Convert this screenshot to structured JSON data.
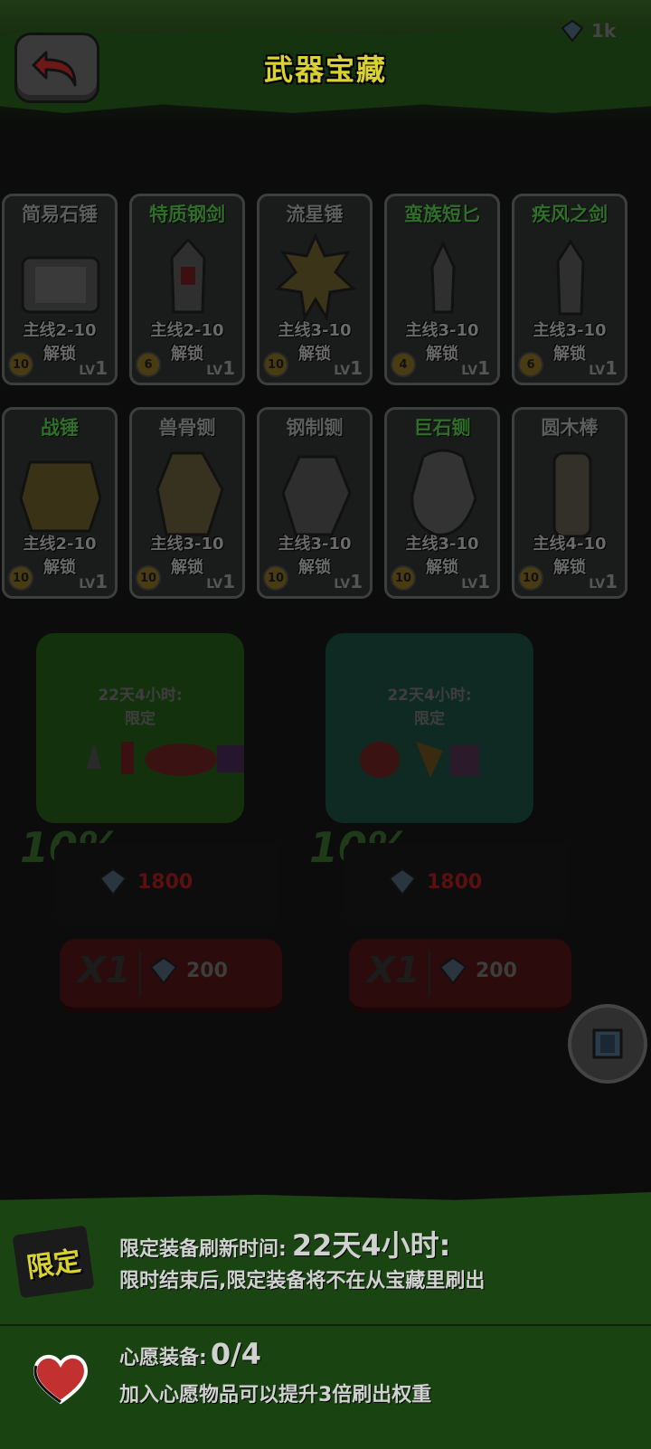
{
  "header": {
    "title": "武器宝藏",
    "currency_amount": "1k"
  },
  "weapons": [
    {
      "name": "简易石锤",
      "unlock": "主线2-10",
      "unlock_suffix": "解锁",
      "count": "10",
      "lv_prefix": "LV",
      "lv": "1",
      "name_color": "gray"
    },
    {
      "name": "特质钢剑",
      "unlock": "主线2-10",
      "unlock_suffix": "解锁",
      "count": "6",
      "lv_prefix": "LV",
      "lv": "1",
      "name_color": "green"
    },
    {
      "name": "流星锤",
      "unlock": "主线3-10",
      "unlock_suffix": "解锁",
      "count": "10",
      "lv_prefix": "LV",
      "lv": "1",
      "name_color": "gray"
    },
    {
      "name": "蛮族短匕",
      "unlock": "主线3-10",
      "unlock_suffix": "解锁",
      "count": "4",
      "lv_prefix": "LV",
      "lv": "1",
      "name_color": "green"
    },
    {
      "name": "疾风之剑",
      "unlock": "主线3-10",
      "unlock_suffix": "解锁",
      "count": "6",
      "lv_prefix": "LV",
      "lv": "1",
      "name_color": "green"
    },
    {
      "name": "战锤",
      "unlock": "主线2-10",
      "unlock_suffix": "解锁",
      "count": "10",
      "lv_prefix": "LV",
      "lv": "1",
      "name_color": "green"
    },
    {
      "name": "兽骨铡",
      "unlock": "主线3-10",
      "unlock_suffix": "解锁",
      "count": "10",
      "lv_prefix": "LV",
      "lv": "1",
      "name_color": "gray"
    },
    {
      "name": "钢制铡",
      "unlock": "主线3-10",
      "unlock_suffix": "解锁",
      "count": "10",
      "lv_prefix": "LV",
      "lv": "1",
      "name_color": "gray"
    },
    {
      "name": "巨石铡",
      "unlock": "主线3-10",
      "unlock_suffix": "解锁",
      "count": "10",
      "lv_prefix": "LV",
      "lv": "1",
      "name_color": "green"
    },
    {
      "name": "圆木棒",
      "unlock": "主线4-10",
      "unlock_suffix": "解锁",
      "count": "10",
      "lv_prefix": "LV",
      "lv": "1",
      "name_color": "gray"
    }
  ],
  "chests": [
    {
      "timer": "22天4小时:",
      "limited": "限定",
      "discount": "10%",
      "price": "1800",
      "buy_qty": "X1",
      "buy_cost": "200"
    },
    {
      "timer": "22天4小时:",
      "limited": "限定",
      "discount": "10%",
      "price": "1800",
      "buy_qty": "X1",
      "buy_cost": "200"
    }
  ],
  "info": {
    "limited_tag": "限定",
    "refresh_label": "限定装备刷新时间:",
    "refresh_value": "22天4小时:",
    "refresh_note": "限时结束后,限定装备将不在从宝藏里刷出",
    "wish_label": "心愿装备:",
    "wish_value": "0/4",
    "wish_note": "加入心愿物品可以提升3倍刷出权重"
  },
  "colors": {
    "title": "#d9d231",
    "panel_green": "#1b4413",
    "back_arrow": "#8c2020"
  }
}
